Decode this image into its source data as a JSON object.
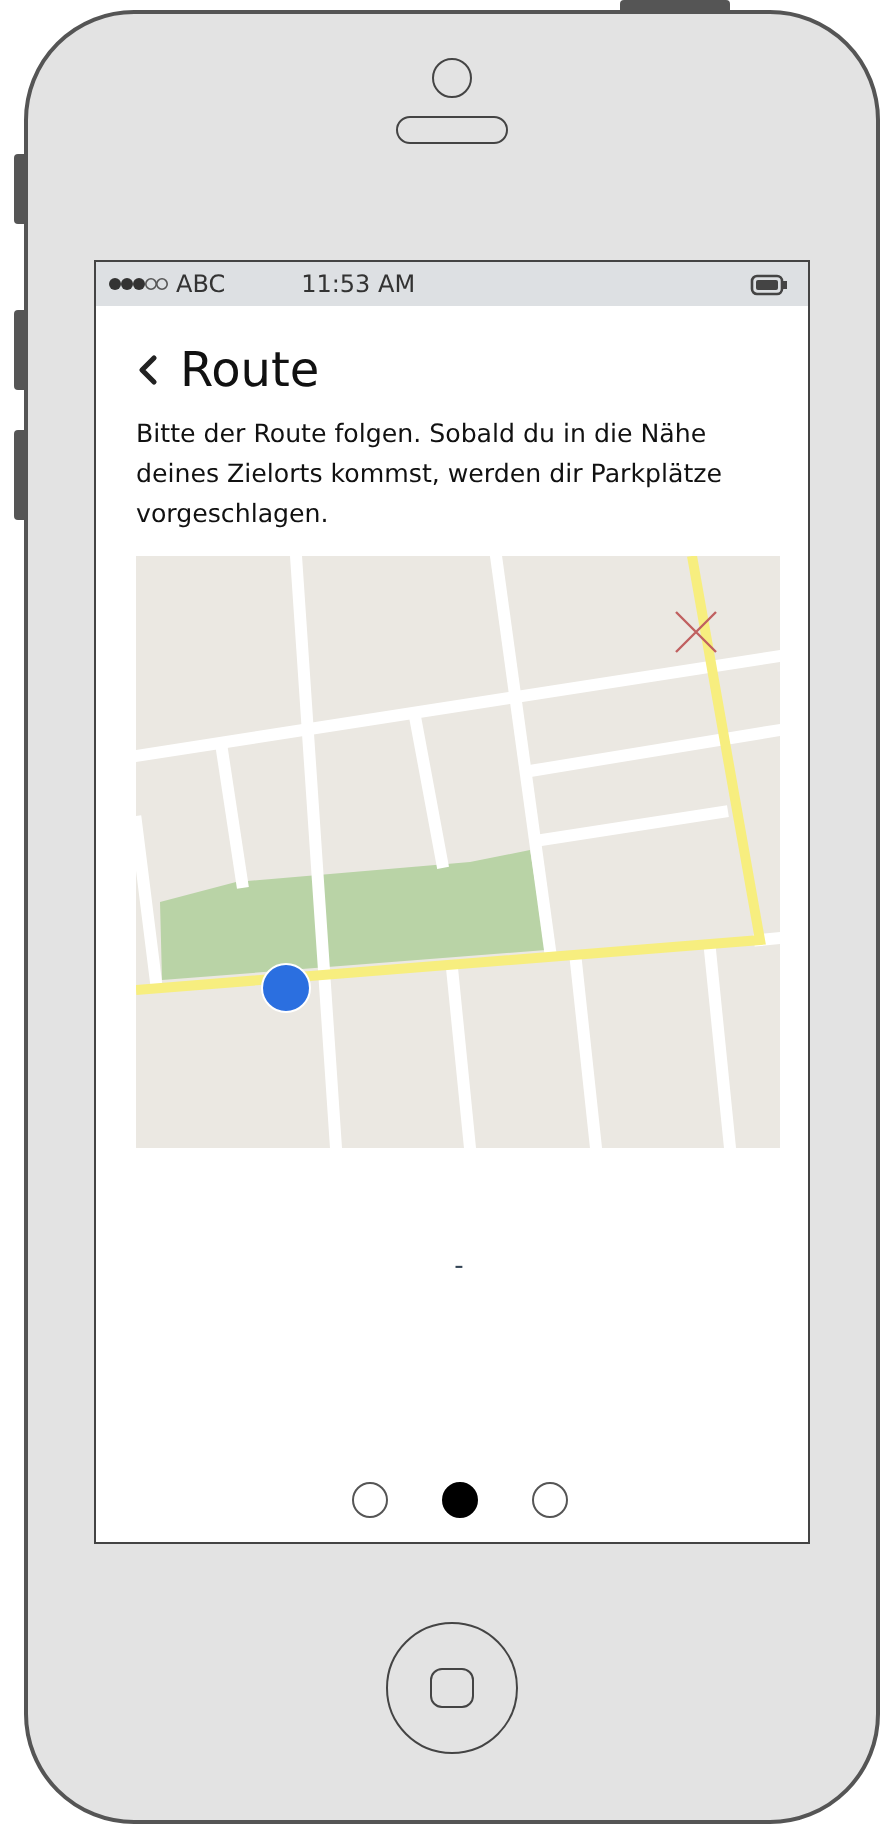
{
  "status_bar": {
    "carrier": "ABC",
    "time": "11:53 AM"
  },
  "header": {
    "title": "Route"
  },
  "description": "Bitte der Route folgen. Sobald du in die Nähe deines Zielorts kommst, werden dir Parkplätze vorgeschlagen.",
  "info_text": "-",
  "page_dots": [
    {
      "selected": false
    },
    {
      "selected": true
    },
    {
      "selected": false
    }
  ]
}
